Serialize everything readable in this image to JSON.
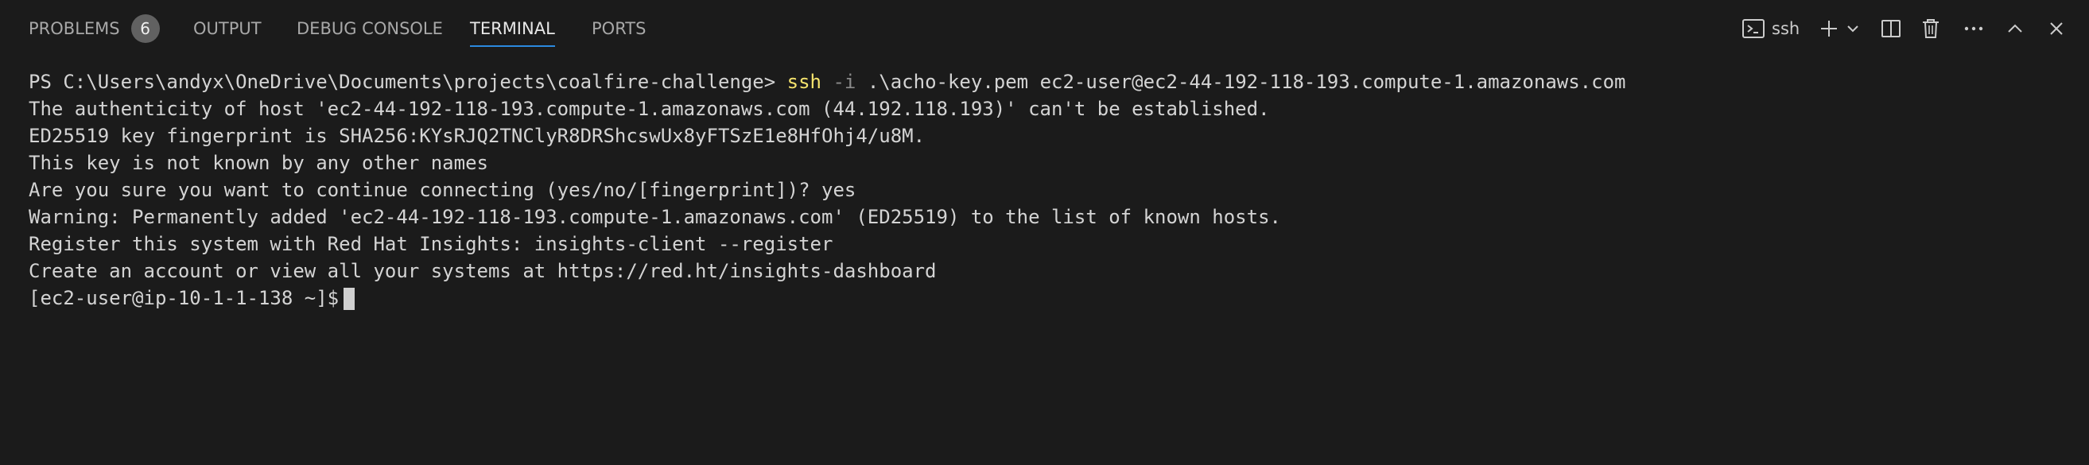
{
  "tabs": [
    {
      "label": "PROBLEMS",
      "badge": "6",
      "active": false
    },
    {
      "label": "OUTPUT",
      "active": false
    },
    {
      "label": "DEBUG CONSOLE",
      "active": false
    },
    {
      "label": "TERMINAL",
      "active": true
    },
    {
      "label": "PORTS",
      "active": false
    }
  ],
  "toolbar": {
    "terminal_name": "ssh",
    "icons": [
      "terminal-icon",
      "plus-icon",
      "chevron-down-icon",
      "split-icon",
      "trash-icon",
      "ellipsis-icon",
      "chevron-up-icon",
      "close-icon"
    ]
  },
  "terminal": {
    "prompt": "PS C:\\Users\\andyx\\OneDrive\\Documents\\projects\\coalfire-challenge> ",
    "command": "ssh",
    "flag": "-i",
    "args": ".\\acho-key.pem ec2-user@ec2-44-192-118-193.compute-1.amazonaws.com",
    "output_lines": [
      "The authenticity of host 'ec2-44-192-118-193.compute-1.amazonaws.com (44.192.118.193)' can't be established.",
      "ED25519 key fingerprint is SHA256:KYsRJQ2TNClyR8DRShcswUx8yFTSzE1e8HfOhj4/u8M.",
      "This key is not known by any other names",
      "Are you sure you want to continue connecting (yes/no/[fingerprint])? yes",
      "Warning: Permanently added 'ec2-44-192-118-193.compute-1.amazonaws.com' (ED25519) to the list of known hosts.",
      "Register this system with Red Hat Insights: insights-client --register",
      "Create an account or view all your systems at https://red.ht/insights-dashboard"
    ],
    "remote_prompt": "[ec2-user@ip-10-1-1-138 ~]$"
  },
  "colors": {
    "background": "#1b1b1b",
    "active_tab_underline": "#2b8ae0",
    "command_highlight": "#f5e36d"
  }
}
